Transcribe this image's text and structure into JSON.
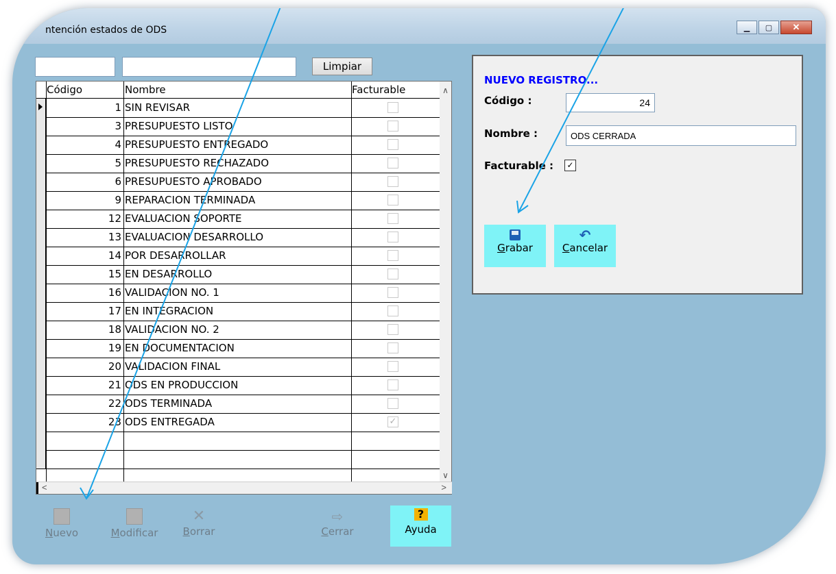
{
  "window": {
    "title": "ntención estados de ODS",
    "controls": {
      "minimize": "▁",
      "maximize": "▢",
      "close": "✕"
    }
  },
  "filter": {
    "code_value": "",
    "name_value": "",
    "clear_label": "Limpiar"
  },
  "grid": {
    "columns": [
      "Código",
      "Nombre",
      "Facturable"
    ],
    "rows": [
      {
        "code": "1",
        "name": "SIN REVISAR",
        "billable": false
      },
      {
        "code": "3",
        "name": "PRESUPUESTO LISTO",
        "billable": false
      },
      {
        "code": "4",
        "name": "PRESUPUESTO ENTREGADO",
        "billable": false
      },
      {
        "code": "5",
        "name": "PRESUPUESTO RECHAZADO",
        "billable": false
      },
      {
        "code": "6",
        "name": "PRESUPUESTO APROBADO",
        "billable": false
      },
      {
        "code": "9",
        "name": "REPARACION TERMINADA",
        "billable": false
      },
      {
        "code": "12",
        "name": "EVALUACION SOPORTE",
        "billable": false
      },
      {
        "code": "13",
        "name": "EVALUACION DESARROLLO",
        "billable": false
      },
      {
        "code": "14",
        "name": "POR DESARROLLAR",
        "billable": false
      },
      {
        "code": "15",
        "name": "EN DESARROLLO",
        "billable": false
      },
      {
        "code": "16",
        "name": "VALIDACION NO. 1",
        "billable": false
      },
      {
        "code": "17",
        "name": "EN INTEGRACION",
        "billable": false
      },
      {
        "code": "18",
        "name": "VALIDACION NO. 2",
        "billable": false
      },
      {
        "code": "19",
        "name": "EN DOCUMENTACION",
        "billable": false
      },
      {
        "code": "20",
        "name": "VALIDACION FINAL",
        "billable": false
      },
      {
        "code": "21",
        "name": "ODS EN PRODUCCION",
        "billable": false
      },
      {
        "code": "22",
        "name": "ODS TERMINADA",
        "billable": false
      },
      {
        "code": "23",
        "name": "ODS ENTREGADA",
        "billable": true
      }
    ]
  },
  "form": {
    "heading": "NUEVO REGISTRO...",
    "code_label": "Código :",
    "code_value": "24",
    "name_label": "Nombre :",
    "name_value": "ODS CERRADA",
    "billable_label": "Facturable :",
    "billable_checked": true,
    "save_label": "Grabar",
    "cancel_label": "Cancelar"
  },
  "toolbar": {
    "new_label": "Nuevo",
    "edit_label": "Modificar",
    "delete_label": "Borrar",
    "close_label": "Cerrar",
    "help_label": "Ayuda"
  },
  "colors": {
    "accent_cyan": "#7ff3f7",
    "background": "#94bdd6",
    "heading_blue": "#0000ff",
    "annotation_arrow": "#1aa3e6"
  }
}
